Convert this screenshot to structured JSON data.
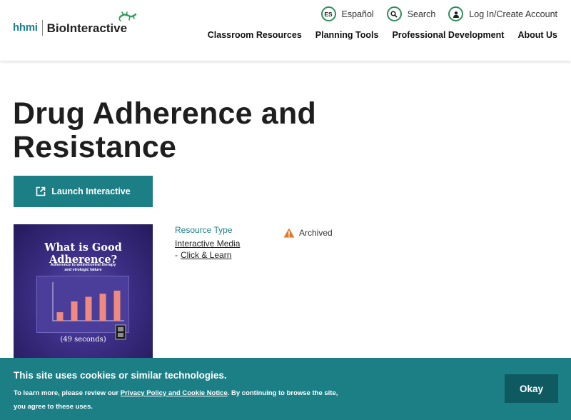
{
  "header": {
    "logo": {
      "hhmi": "hhmi",
      "brand": "BioInteractive"
    },
    "utility": [
      {
        "icon_text": "ES",
        "label": "Español"
      },
      {
        "icon": "search-icon",
        "label": "Search"
      },
      {
        "icon": "user-icon",
        "label": "Log In/Create Account"
      }
    ],
    "nav": [
      "Classroom Resources",
      "Planning Tools",
      "Professional Development",
      "About Us"
    ]
  },
  "page": {
    "title": "Drug Adherence and Resistance",
    "launch_label": "Launch Interactive",
    "thumbnail": {
      "title": "What is Good Adherence?",
      "subtitle_line1": "Adherence to antiretroviral therapy",
      "subtitle_line2": "and virologic failure",
      "duration": "(49 seconds)",
      "chart_bars": [
        0.22,
        0.5,
        0.62,
        0.7,
        0.78
      ]
    },
    "resource_type": {
      "label": "Resource Type",
      "link1": "Interactive Media",
      "dash": "-",
      "link2": "Click & Learn"
    },
    "status": {
      "icon": "warning-icon",
      "label": "Archived"
    }
  },
  "cookie": {
    "title": "This site uses cookies or similar technologies.",
    "text_before": "To learn more, please review our ",
    "link": "Privacy Policy and Cookie Notice",
    "text_after": ". By continuing to browse the site, you agree to these uses.",
    "button": "Okay"
  },
  "colors": {
    "teal": "#1c7f86",
    "dark_teal": "#0e5a60",
    "green_ring": "#2e8f5c",
    "warning": "#e07a2e"
  }
}
